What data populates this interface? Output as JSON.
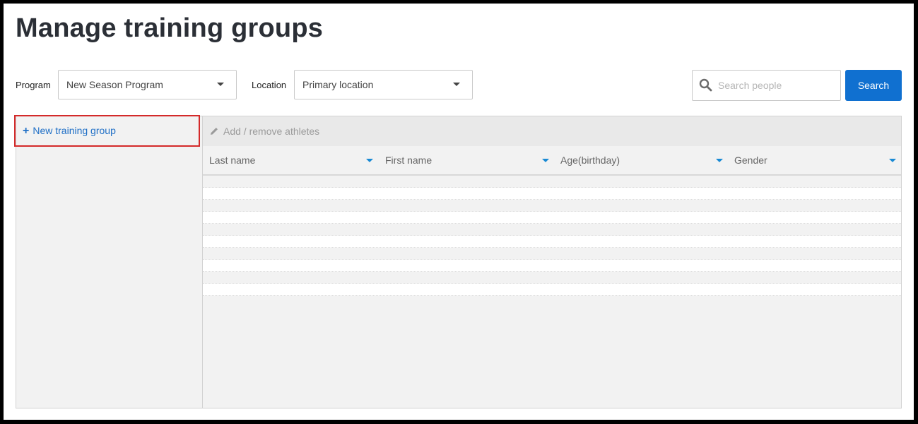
{
  "page": {
    "title": "Manage training groups"
  },
  "filters": {
    "program_label": "Program",
    "program_value": "New Season Program",
    "location_label": "Location",
    "location_value": "Primary location"
  },
  "search": {
    "placeholder": "Search people",
    "value": "",
    "button_label": "Search"
  },
  "sidebar": {
    "new_group_label": "New training group"
  },
  "toolbar": {
    "edit_label": "Add / remove athletes"
  },
  "table": {
    "columns": [
      {
        "label": "Last name"
      },
      {
        "label": "First name"
      },
      {
        "label": "Age(birthday)"
      },
      {
        "label": "Gender"
      }
    ],
    "empty_row_count": 10
  },
  "icons": {
    "search": "search-icon",
    "pencil": "pencil-icon",
    "plus": "plus-icon",
    "caret": "caret-down-icon"
  },
  "colors": {
    "accent": "#1070d0",
    "link": "#1f6fc6",
    "highlight_border": "#d42a2a",
    "sort_caret": "#1a8ad4"
  }
}
